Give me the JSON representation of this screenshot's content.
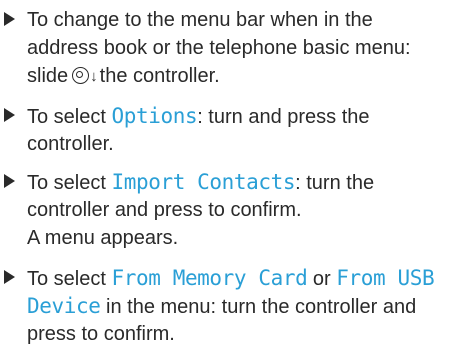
{
  "steps": [
    {
      "line1": "To change to the menu bar when in the",
      "line2": "address book or the telephone basic menu:",
      "line3_pre": "slide",
      "arrow": "↓",
      "line3_post": "the controller."
    },
    {
      "pre": "To select ",
      "highlight": "Options",
      "post": ": turn and press the",
      "line2": "controller."
    },
    {
      "pre": "To select ",
      "highlight": "Import Contacts",
      "post": ": turn the",
      "line2": "controller and press to confirm.",
      "line3": "A menu appears."
    },
    {
      "pre": "To select ",
      "highlight1": "From Memory Card",
      "mid": " or ",
      "highlight2a": "From USB",
      "highlight2b": "Device",
      "post": " in the menu: turn the controller and",
      "line3": "press to confirm."
    }
  ],
  "colors": {
    "text": "#2a2a2a",
    "highlight": "#2a9fd6"
  },
  "icons": {
    "bullet": "bullet-arrow-icon",
    "controller": "controller-icon",
    "slide": "arrow-down-icon"
  }
}
